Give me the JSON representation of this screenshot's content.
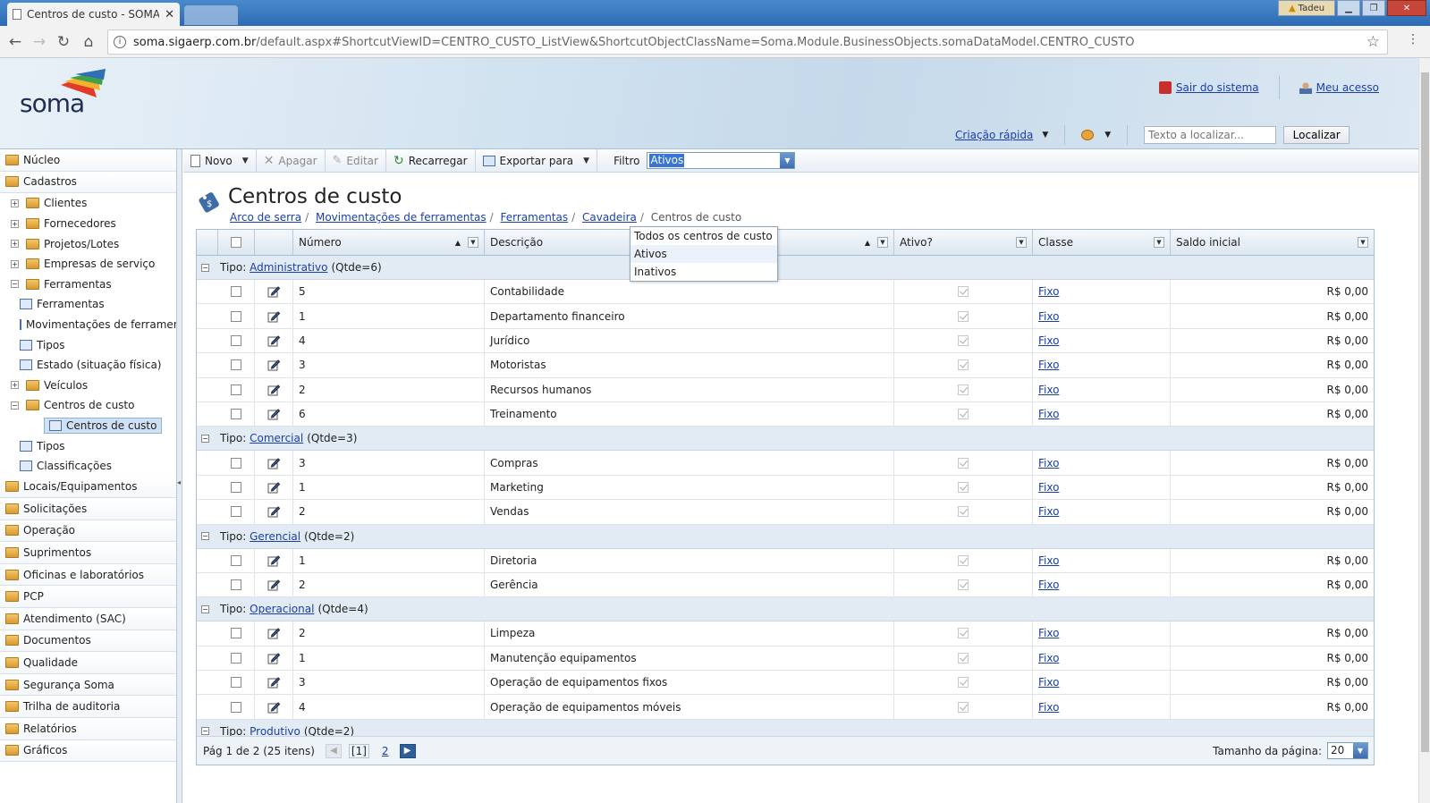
{
  "browser": {
    "tab_title": "Centros de custo - SOMA",
    "user_badge": "Tadeu",
    "url_host": "soma.sigaerp.com.br",
    "url_path": "/default.aspx#ShortcutViewID=CENTRO_CUSTO_ListView&ShortcutObjectClassName=Soma.Module.BusinessObjects.somaDataModel.CENTRO_CUSTO"
  },
  "header": {
    "logo_text": "soma",
    "logout": "Sair do sistema",
    "my_access": "Meu acesso",
    "quick_create": "Criação rápida",
    "search_placeholder": "Texto a localizar...",
    "search_button": "Localizar"
  },
  "sidebar": {
    "top_before": [
      "Núcleo",
      "Cadastros"
    ],
    "sub": [
      {
        "label": "Clientes",
        "level": 1,
        "exp": "+"
      },
      {
        "label": "Fornecedores",
        "level": 1,
        "exp": "+"
      },
      {
        "label": "Projetos/Lotes",
        "level": 1,
        "exp": "+"
      },
      {
        "label": "Empresas de serviço",
        "level": 1,
        "exp": "+"
      },
      {
        "label": "Ferramentas",
        "level": 1,
        "exp": "−"
      },
      {
        "label": "Ferramentas",
        "level": 2
      },
      {
        "label": "Movimentações de ferramentas",
        "level": 2
      },
      {
        "label": "Tipos",
        "level": 2
      },
      {
        "label": "Estado (situação física)",
        "level": 2
      },
      {
        "label": "Veículos",
        "level": 1,
        "exp": "+"
      },
      {
        "label": "Centros de custo",
        "level": 1,
        "exp": "−"
      },
      {
        "label": "Centros de custo",
        "level": 2,
        "selected": true
      },
      {
        "label": "Tipos",
        "level": 2
      },
      {
        "label": "Classificações",
        "level": 2
      }
    ],
    "top_after": [
      "Locais/Equipamentos",
      "Solicitações",
      "Operação",
      "Suprimentos",
      "Oficinas e laboratórios",
      "PCP",
      "Atendimento (SAC)",
      "Documentos",
      "Qualidade",
      "Segurança Soma",
      "Trilha de auditoria",
      "Relatórios",
      "Gráficos"
    ]
  },
  "toolbar": {
    "new": "Novo",
    "delete": "Apagar",
    "edit": "Editar",
    "reload": "Recarregar",
    "export": "Exportar para",
    "filter_label": "Filtro",
    "filter_value": "Ativos",
    "filter_options": [
      "Todos os centros de custo",
      "Ativos",
      "Inativos"
    ]
  },
  "page": {
    "title": "Centros de custo",
    "breadcrumb": [
      "Arco de serra",
      "Movimentações de ferramentas",
      "Ferramentas",
      "Cavadeira"
    ],
    "breadcrumb_current": "Centros de custo"
  },
  "grid": {
    "columns": [
      "Número",
      "Descrição",
      "Ativo?",
      "Classe",
      "Saldo inicial"
    ],
    "group_prefix": "Tipo:",
    "groups": [
      {
        "name": "Administrativo",
        "count": "(Qtde=6)",
        "rows": [
          {
            "numero": "5",
            "descricao": "Contabilidade",
            "classe": "Fixo",
            "saldo": "R$ 0,00"
          },
          {
            "numero": "1",
            "descricao": "Departamento financeiro",
            "classe": "Fixo",
            "saldo": "R$ 0,00"
          },
          {
            "numero": "4",
            "descricao": "Jurídico",
            "classe": "Fixo",
            "saldo": "R$ 0,00"
          },
          {
            "numero": "3",
            "descricao": "Motoristas",
            "classe": "Fixo",
            "saldo": "R$ 0,00"
          },
          {
            "numero": "2",
            "descricao": "Recursos humanos",
            "classe": "Fixo",
            "saldo": "R$ 0,00"
          },
          {
            "numero": "6",
            "descricao": "Treinamento",
            "classe": "Fixo",
            "saldo": "R$ 0,00"
          }
        ]
      },
      {
        "name": "Comercial",
        "count": "(Qtde=3)",
        "rows": [
          {
            "numero": "3",
            "descricao": "Compras",
            "classe": "Fixo",
            "saldo": "R$ 0,00"
          },
          {
            "numero": "1",
            "descricao": "Marketing",
            "classe": "Fixo",
            "saldo": "R$ 0,00"
          },
          {
            "numero": "2",
            "descricao": "Vendas",
            "classe": "Fixo",
            "saldo": "R$ 0,00"
          }
        ]
      },
      {
        "name": "Gerencial",
        "count": "(Qtde=2)",
        "rows": [
          {
            "numero": "1",
            "descricao": "Diretoria",
            "classe": "Fixo",
            "saldo": "R$ 0,00"
          },
          {
            "numero": "2",
            "descricao": "Gerência",
            "classe": "Fixo",
            "saldo": "R$ 0,00"
          }
        ]
      },
      {
        "name": "Operacional",
        "count": "(Qtde=4)",
        "rows": [
          {
            "numero": "2",
            "descricao": "Limpeza",
            "classe": "Fixo",
            "saldo": "R$ 0,00"
          },
          {
            "numero": "1",
            "descricao": "Manutenção equipamentos",
            "classe": "Fixo",
            "saldo": "R$ 0,00"
          },
          {
            "numero": "3",
            "descricao": "Operação de equipamentos fixos",
            "classe": "Fixo",
            "saldo": "R$ 0,00"
          },
          {
            "numero": "4",
            "descricao": "Operação de equipamentos móveis",
            "classe": "Fixo",
            "saldo": "R$ 0,00"
          }
        ]
      },
      {
        "name": "Produtivo",
        "count": "(Qtde=2)",
        "rows": []
      }
    ],
    "footer": {
      "page_info": "Pág 1 de 2 (25 itens)",
      "current_page": "[1]",
      "next_page": "2",
      "page_size_label": "Tamanho da página:",
      "page_size": "20"
    }
  }
}
